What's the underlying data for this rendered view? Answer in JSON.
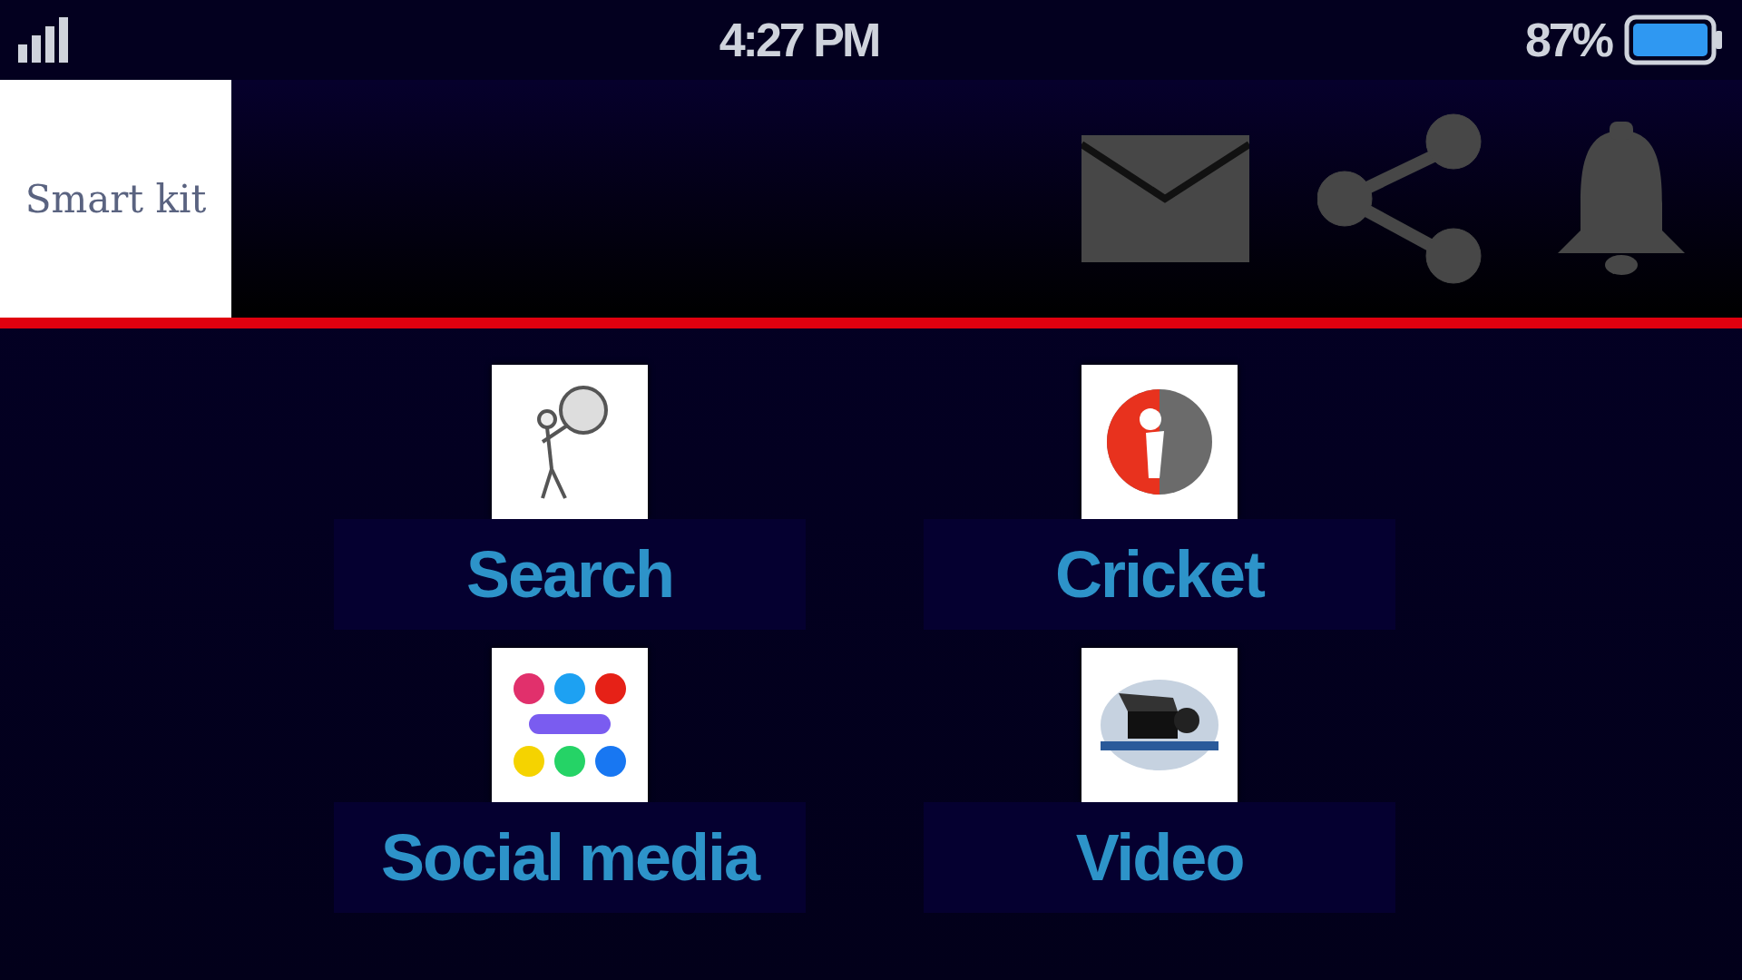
{
  "status_bar": {
    "time": "4:27 PM",
    "battery": "87%"
  },
  "header": {
    "logo": "Smart kit"
  },
  "tiles": [
    {
      "kind": "search",
      "label": "Search"
    },
    {
      "kind": "cricket",
      "label": "Cricket"
    },
    {
      "kind": "social",
      "label": "Social media"
    },
    {
      "kind": "video",
      "label": "Video"
    }
  ]
}
